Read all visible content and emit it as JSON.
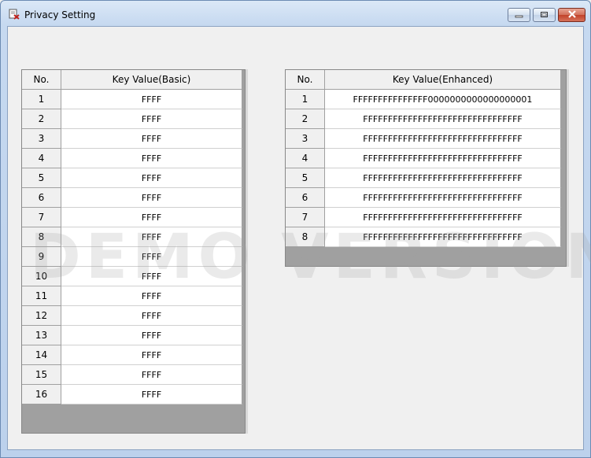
{
  "window": {
    "title": "Privacy Setting",
    "icons": {
      "app": "app-icon",
      "minimize": "minimize-icon",
      "maximize": "maximize-icon",
      "close": "close-icon"
    }
  },
  "watermark": "DEMO VERSION",
  "basic_table": {
    "headers": [
      "No.",
      "Key Value(Basic)"
    ],
    "rows": [
      {
        "no": "1",
        "value": "FFFF"
      },
      {
        "no": "2",
        "value": "FFFF"
      },
      {
        "no": "3",
        "value": "FFFF"
      },
      {
        "no": "4",
        "value": "FFFF"
      },
      {
        "no": "5",
        "value": "FFFF"
      },
      {
        "no": "6",
        "value": "FFFF"
      },
      {
        "no": "7",
        "value": "FFFF"
      },
      {
        "no": "8",
        "value": "FFFF"
      },
      {
        "no": "9",
        "value": "FFFF"
      },
      {
        "no": "10",
        "value": "FFFF"
      },
      {
        "no": "11",
        "value": "FFFF"
      },
      {
        "no": "12",
        "value": "FFFF"
      },
      {
        "no": "13",
        "value": "FFFF"
      },
      {
        "no": "14",
        "value": "FFFF"
      },
      {
        "no": "15",
        "value": "FFFF"
      },
      {
        "no": "16",
        "value": "FFFF"
      }
    ]
  },
  "enhanced_table": {
    "headers": [
      "No.",
      "Key Value(Enhanced)"
    ],
    "rows": [
      {
        "no": "1",
        "value": "FFFFFFFFFFFFFFF0000000000000000001"
      },
      {
        "no": "2",
        "value": "FFFFFFFFFFFFFFFFFFFFFFFFFFFFFFFF"
      },
      {
        "no": "3",
        "value": "FFFFFFFFFFFFFFFFFFFFFFFFFFFFFFFF"
      },
      {
        "no": "4",
        "value": "FFFFFFFFFFFFFFFFFFFFFFFFFFFFFFFF"
      },
      {
        "no": "5",
        "value": "FFFFFFFFFFFFFFFFFFFFFFFFFFFFFFFF"
      },
      {
        "no": "6",
        "value": "FFFFFFFFFFFFFFFFFFFFFFFFFFFFFFFF"
      },
      {
        "no": "7",
        "value": "FFFFFFFFFFFFFFFFFFFFFFFFFFFFFFFF"
      },
      {
        "no": "8",
        "value": "FFFFFFFFFFFFFFFFFFFFFFFFFFFFFFFF"
      }
    ]
  }
}
